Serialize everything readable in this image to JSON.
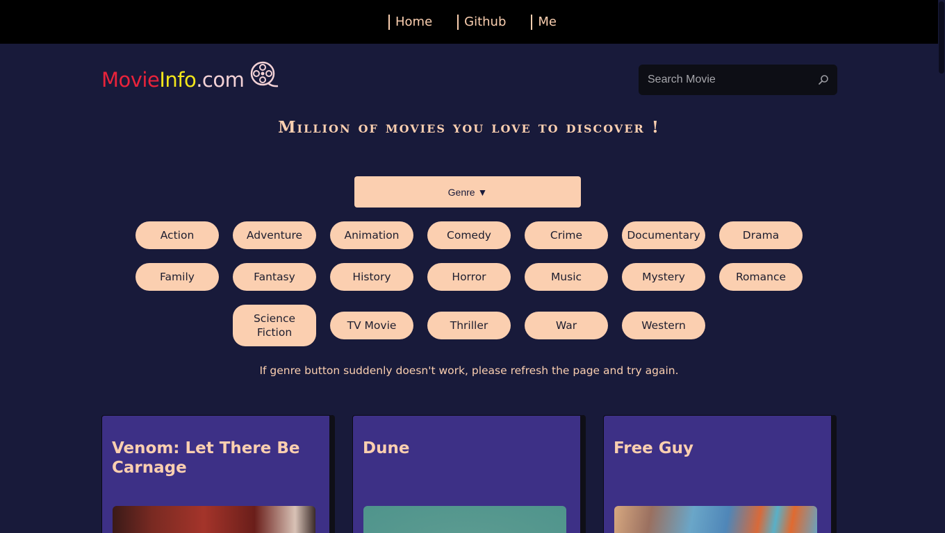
{
  "nav": {
    "links": [
      "Home",
      "Github",
      "Me"
    ]
  },
  "logo": {
    "part1": "Movie",
    "part2": "Info",
    "part3": ".com",
    "icon": "film-reel-icon"
  },
  "search": {
    "placeholder": "Search Movie",
    "value": "",
    "icon": "search-icon"
  },
  "tagline": "Million of movies you love to discover !",
  "genre_toggle": {
    "label": "Genre ▼"
  },
  "genres": [
    "Action",
    "Adventure",
    "Animation",
    "Comedy",
    "Crime",
    "Documentary",
    "Drama",
    "Family",
    "Fantasy",
    "History",
    "Horror",
    "Music",
    "Mystery",
    "Romance",
    "Science Fiction",
    "TV Movie",
    "Thriller",
    "War",
    "Western"
  ],
  "notice": "If genre button suddenly doesn't work, please refresh the page and try again.",
  "movies": [
    {
      "title": "Venom: Let There Be Carnage"
    },
    {
      "title": "Dune"
    },
    {
      "title": "Free Guy"
    }
  ],
  "colors": {
    "background": "#181a3a",
    "accent": "#fbcfb0",
    "card": "#3d3086",
    "logo_red": "#e8233b",
    "logo_yellow": "#f2e61a"
  }
}
